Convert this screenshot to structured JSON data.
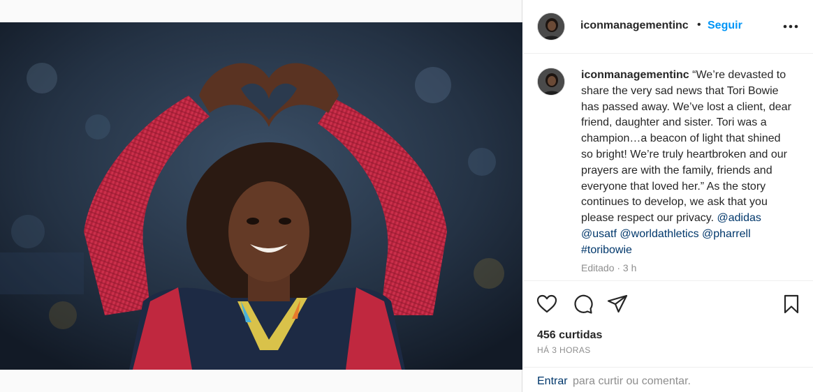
{
  "post": {
    "username": "iconmanagementinc",
    "follow_label": "Seguir",
    "separator": "•",
    "more_label": "Mais opções"
  },
  "caption": {
    "username": "iconmanagementinc",
    "text": "“We’re devasted to share the very sad news that Tori Bowie has passed away. We’ve lost a client, dear friend, daughter and sister. Tori was a champion…a beacon of light that shined so bright! We’re truly heartbroken and our prayers are with the family, friends and everyone that loved her.” As the story continues to develop, we ask that you please respect our privacy.",
    "tags": [
      "@adidas",
      "@usatf",
      "@worldathletics",
      "@pharrell",
      "#toribowie"
    ],
    "meta": "Editado · 3 h"
  },
  "stats": {
    "likes": "456 curtidas",
    "time": "HÁ 3 HORAS"
  },
  "login": {
    "link": "Entrar",
    "rest": "para curtir ou comentar."
  },
  "icons": {
    "like": "heart-outline-icon",
    "comment": "speech-bubble-icon",
    "share": "paper-plane-icon",
    "save": "bookmark-icon",
    "more": "ellipsis-icon"
  },
  "colors": {
    "link_blue": "#0095f6",
    "tag_blue": "#00376b",
    "muted": "#8e8e8e",
    "text": "#262626"
  }
}
